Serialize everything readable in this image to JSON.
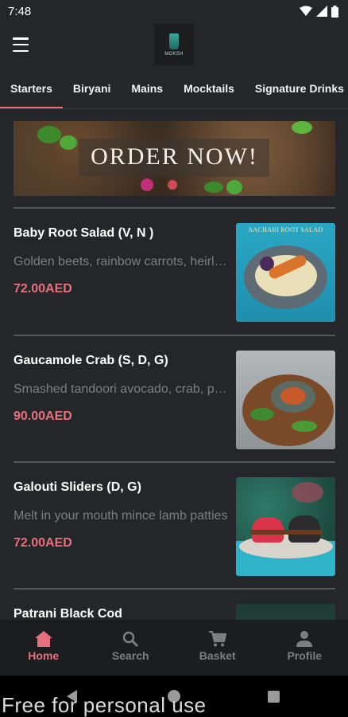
{
  "status_bar": {
    "time": "7:48",
    "icons": [
      "wifi-icon",
      "signal-icon",
      "battery-icon"
    ]
  },
  "app_bar": {
    "menu_icon": "hamburger-menu-icon",
    "logo_text": "MOKSH"
  },
  "tabs": [
    {
      "label": "Starters",
      "active": true
    },
    {
      "label": "Biryani",
      "active": false
    },
    {
      "label": "Mains",
      "active": false
    },
    {
      "label": "Mocktails",
      "active": false
    },
    {
      "label": "Signature Drinks",
      "active": false
    }
  ],
  "banner": {
    "text": "ORDER NOW!"
  },
  "menu_items": [
    {
      "title": "Baby Root Salad (V, N )",
      "description": "Golden beets, rainbow carrots, heirloom radish",
      "price": "72.00AED",
      "photo_label": "AACHARI ROOT SALAD"
    },
    {
      "title": "Gaucamole Crab (S, D, G)",
      "description": "Smashed tandoori avocado, crab, papad",
      "price": "90.00AED"
    },
    {
      "title": "Galouti Sliders (D, G)",
      "description": "Melt in your mouth mince lamb patties",
      "price": "72.00AED"
    },
    {
      "title": "Patrani Black Cod"
    }
  ],
  "bottom_nav": [
    {
      "label": "Home",
      "icon": "home-icon",
      "active": true
    },
    {
      "label": "Search",
      "icon": "search-icon",
      "active": false
    },
    {
      "label": "Basket",
      "icon": "cart-icon",
      "active": false
    },
    {
      "label": "Profile",
      "icon": "profile-icon",
      "active": false
    }
  ],
  "watermark": "Free for personal use",
  "colors": {
    "accent": "#e8707a",
    "background": "#252629",
    "nav_background": "#1c1d20",
    "muted_text": "#7d7e82"
  }
}
